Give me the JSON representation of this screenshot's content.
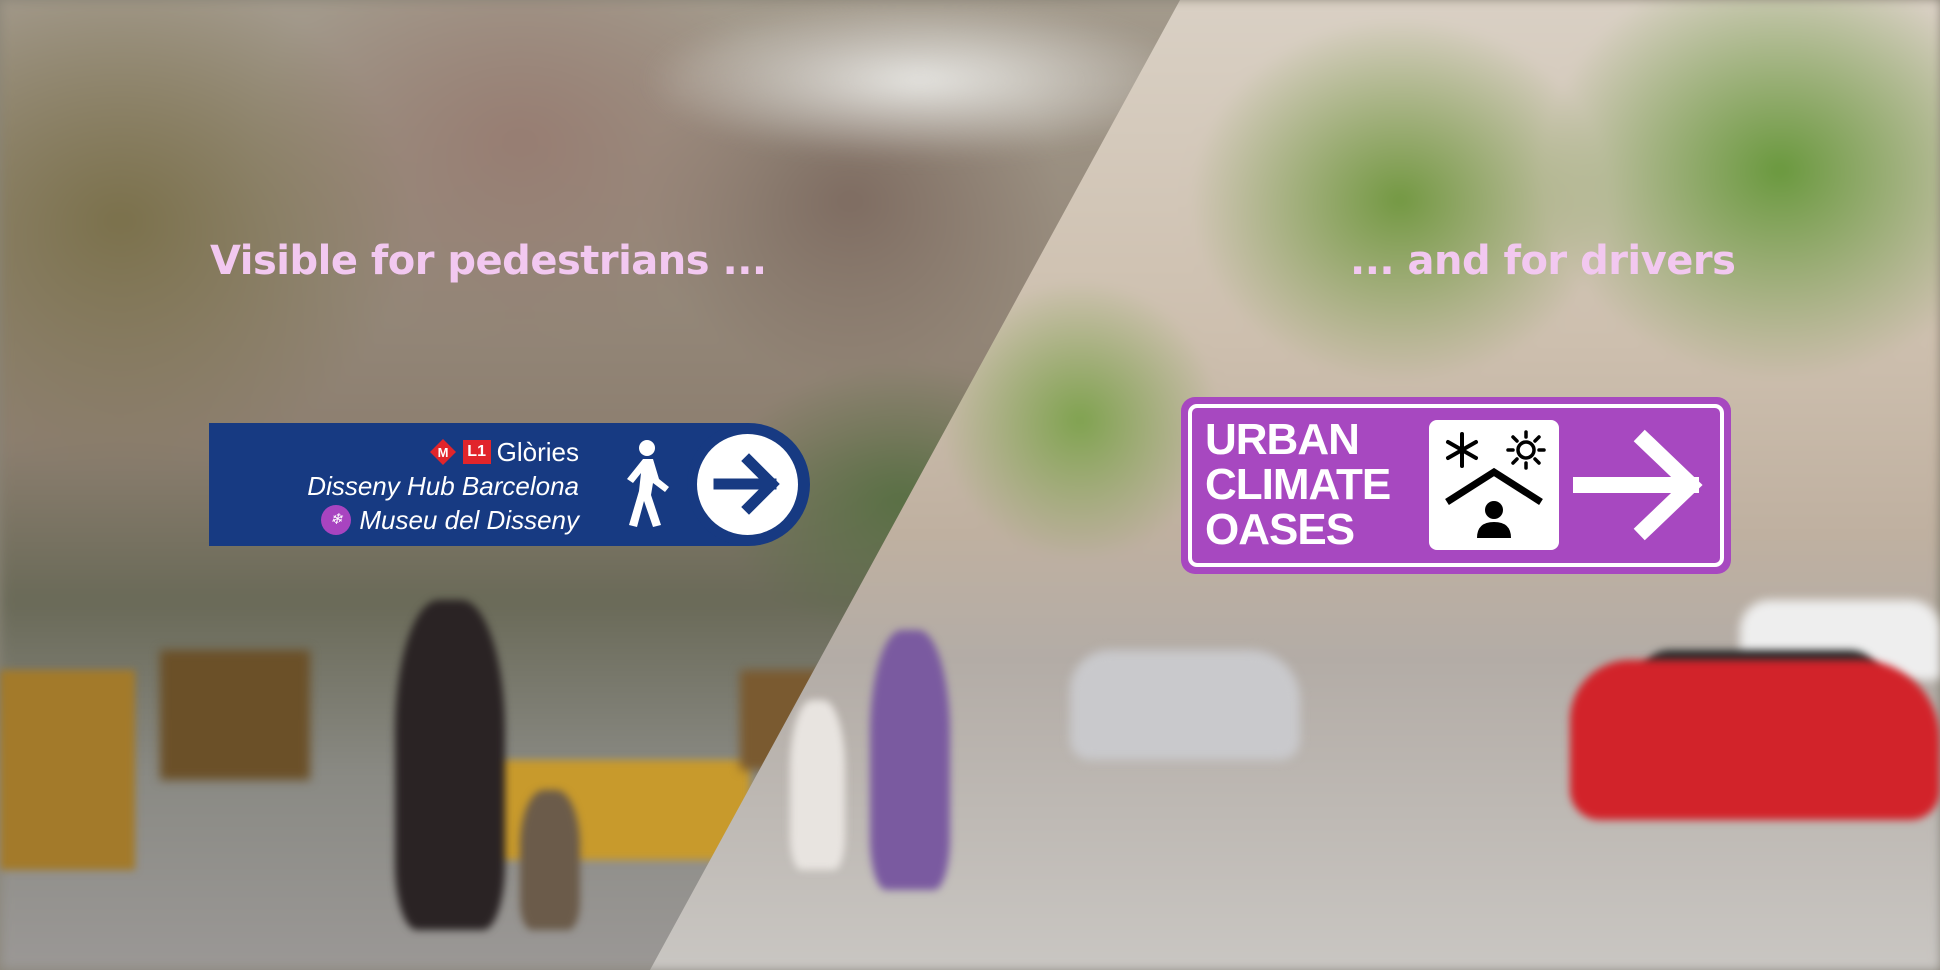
{
  "headings": {
    "left": "Visible for pedestrians ...",
    "right": "... and for drivers"
  },
  "pedestrian_sign": {
    "metro_letter": "M",
    "line": "L1",
    "station": "Glòries",
    "line2": "Disseny Hub Barcelona",
    "line3": "Museu del Disseny",
    "colors": {
      "background": "#173a82",
      "metro": "#e1252b",
      "museum": "#a844c0"
    },
    "icons": [
      "metro-diamond-icon",
      "museum-icon",
      "pedestrian-icon",
      "arrow-right-icon"
    ]
  },
  "driver_sign": {
    "lines": [
      "URBAN",
      "CLIMATE",
      "OASES"
    ],
    "colors": {
      "background": "#a748c0"
    },
    "icons": [
      "snowflake-icon",
      "sun-icon",
      "house-person-icon",
      "arrow-right-icon"
    ]
  },
  "colors": {
    "heading": "#f2c8f0"
  }
}
